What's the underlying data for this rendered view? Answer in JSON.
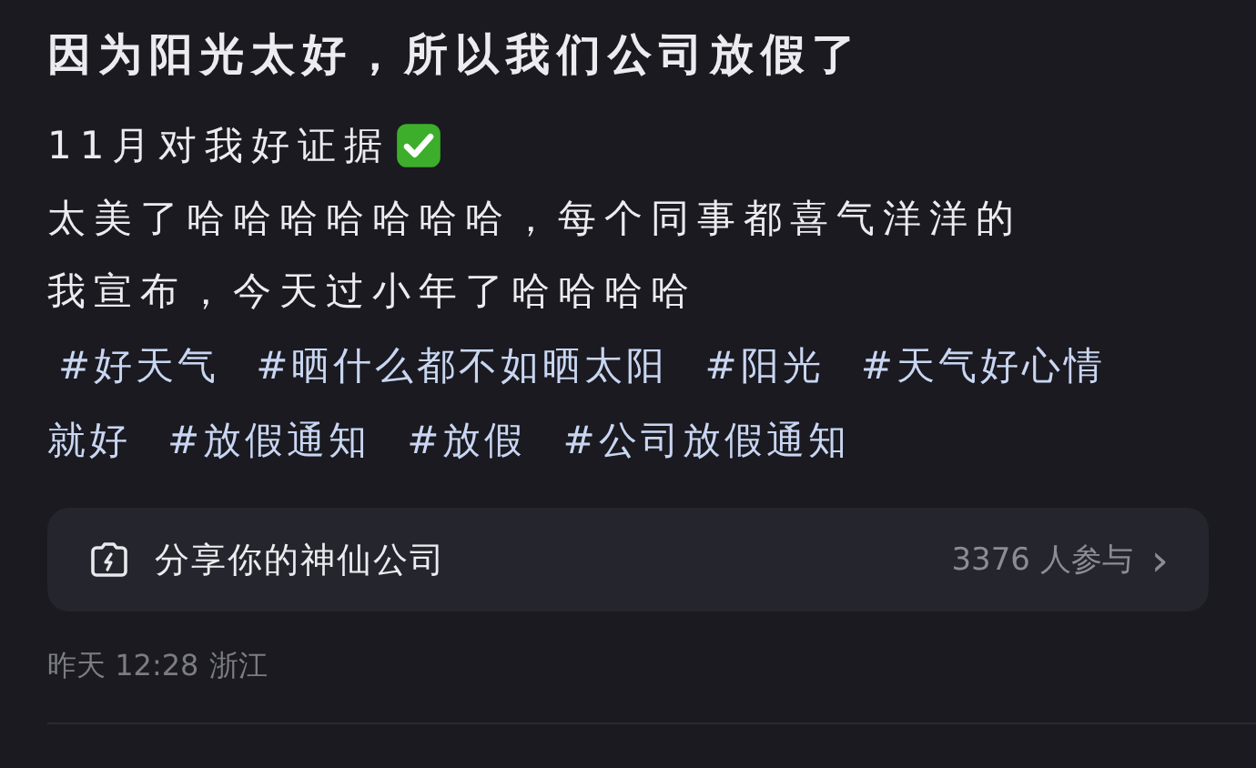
{
  "post": {
    "title": "因为阳光太好，所以我们公司放假了",
    "lines": [
      {
        "text": "11月对我好证据",
        "check_emoji": true
      },
      {
        "text": "太美了哈哈哈哈哈哈哈，每个同事都喜气洋洋的",
        "check_emoji": false
      },
      {
        "text": "我宣布，今天过小年了哈哈哈哈",
        "check_emoji": false
      }
    ],
    "hashtag_lines": [
      [
        "#好天气",
        "#晒什么都不如晒太阳",
        "#阳光",
        "#天气好心情"
      ],
      [
        "就好",
        "#放假通知",
        "#放假",
        "#公司放假通知"
      ]
    ],
    "topic_card": {
      "title": "分享你的神仙公司",
      "participants": "3376 人参与",
      "chevron": "›"
    },
    "meta": {
      "time": "昨天 12:28",
      "location": "浙江"
    }
  }
}
